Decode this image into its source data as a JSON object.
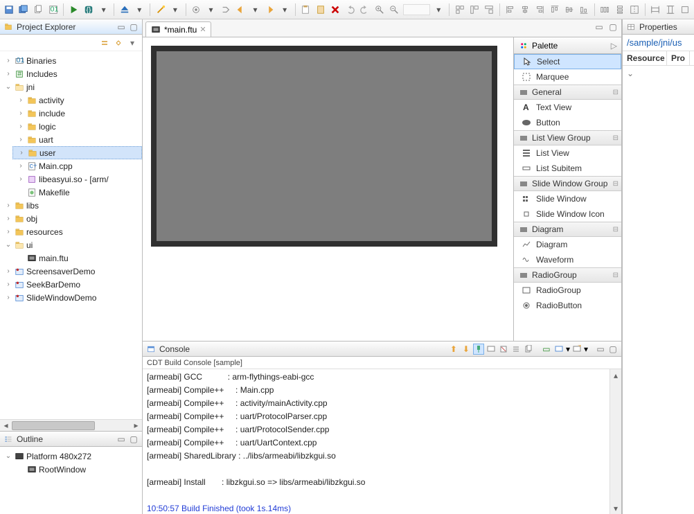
{
  "explorer": {
    "title": "Project Explorer",
    "items": {
      "binaries": "Binaries",
      "includes": "Includes",
      "jni": "jni",
      "activity": "activity",
      "include": "include",
      "logic": "logic",
      "uart": "uart",
      "user": "user",
      "main_cpp": "Main.cpp",
      "libeasyui": "libeasyui.so - [arm/",
      "makefile": "Makefile",
      "libs": "libs",
      "obj": "obj",
      "resources": "resources",
      "ui": "ui",
      "main_ftu": "main.ftu",
      "screensaver": "ScreensaverDemo",
      "seekbar": "SeekBarDemo",
      "slidewindow": "SlideWindowDemo"
    }
  },
  "outline": {
    "title": "Outline",
    "platform": "Platform 480x272",
    "root": "RootWindow"
  },
  "editor": {
    "tab": "*main.ftu"
  },
  "palette": {
    "title": "Palette",
    "select": "Select",
    "marquee": "Marquee",
    "general": "General",
    "textview": "Text View",
    "button": "Button",
    "listview_group": "List View Group",
    "listview": "List View",
    "listsubitem": "List Subitem",
    "slidewindow_group": "Slide Window Group",
    "slidewindow": "Slide Window",
    "slidewindow_icon": "Slide Window Icon",
    "diagram_cat": "Diagram",
    "diagram": "Diagram",
    "waveform": "Waveform",
    "radiogroup_cat": "RadioGroup",
    "radiogroup": "RadioGroup",
    "radiobutton": "RadioButton"
  },
  "console": {
    "title": "Console",
    "subtitle": "CDT Build Console [sample]",
    "lines": [
      "[armeabi] GCC           : arm-flythings-eabi-gcc",
      "[armeabi] Compile++     : Main.cpp",
      "[armeabi] Compile++     : activity/mainActivity.cpp",
      "[armeabi] Compile++     : uart/ProtocolParser.cpp",
      "[armeabi] Compile++     : uart/ProtocolSender.cpp",
      "[armeabi] Compile++     : uart/UartContext.cpp",
      "[armeabi] SharedLibrary : ../libs/armeabi/libzkgui.so",
      "",
      "[armeabi] Install       : libzkgui.so => libs/armeabi/libzkgui.so",
      ""
    ],
    "finished": "10:50:57 Build Finished (took 1s.14ms)"
  },
  "properties": {
    "title": "Properties",
    "link": "/sample/jni/us",
    "col1": "Resource",
    "col2": "Pro"
  }
}
